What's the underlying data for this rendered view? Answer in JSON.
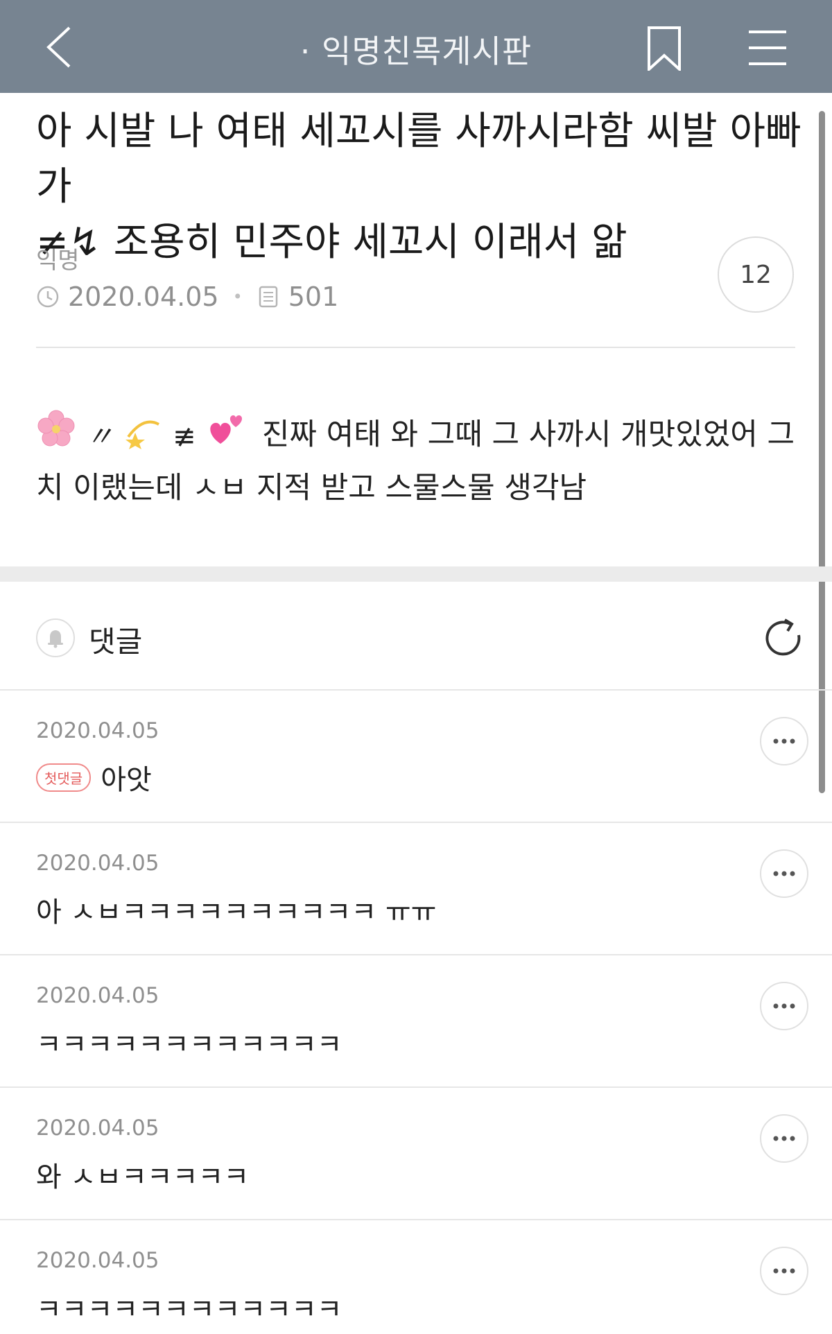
{
  "header": {
    "title": "· 익명친목게시판",
    "icons": [
      "chevron-left-icon",
      "bookmark-icon",
      "menu-icon"
    ]
  },
  "post": {
    "title": "아 시발 나 여태 세꼬시를 사까시라함 씨발 아빠가 🚫 조용히 민주야 세꼬시 이래서 앎",
    "title_line1": "아 시발 나 여태 세꼬시를 사까시라함 씨발 아빠가",
    "title_line2_prefix": "≠↯",
    "title_line2": "조용히 민주야 세꼬시 이래서 앎",
    "author": "익명",
    "date": "2020.04.05",
    "views": "501",
    "comment_count": "12",
    "body_line1": "진짜 여태 와 그때 그 사까시 개맛있었어 그",
    "body_line2": "치 이랬는데 ㅅㅂ 지적 받고 스물스물 생각남",
    "body_emoji": [
      "🌸",
      "〃",
      "💫",
      "≢",
      "💕"
    ]
  },
  "comments_section": {
    "label": "댓글"
  },
  "comments": [
    {
      "date": "2020.04.05",
      "badge": "첫댓글",
      "text": "아앗"
    },
    {
      "date": "2020.04.05",
      "badge": "",
      "text": "아 ㅅㅂㅋㅋㅋㅋㅋㅋㅋㅋㅋㅋ ㅠㅠ"
    },
    {
      "date": "2020.04.05",
      "badge": "",
      "text": "ㅋㅋㅋㅋㅋㅋㅋㅋㅋㅋㅋㅋ"
    },
    {
      "date": "2020.04.05",
      "badge": "",
      "text": "와 ㅅㅂㅋㅋㅋㅋㅋ"
    },
    {
      "date": "2020.04.05",
      "badge": "",
      "text": "ㅋㅋㅋㅋㅋㅋㅋㅋㅋㅋㅋㅋ"
    }
  ],
  "colors": {
    "header_bg": "#778491",
    "badge_red": "#e45b5b",
    "text": "#222222",
    "muted": "#8f8f8f"
  }
}
